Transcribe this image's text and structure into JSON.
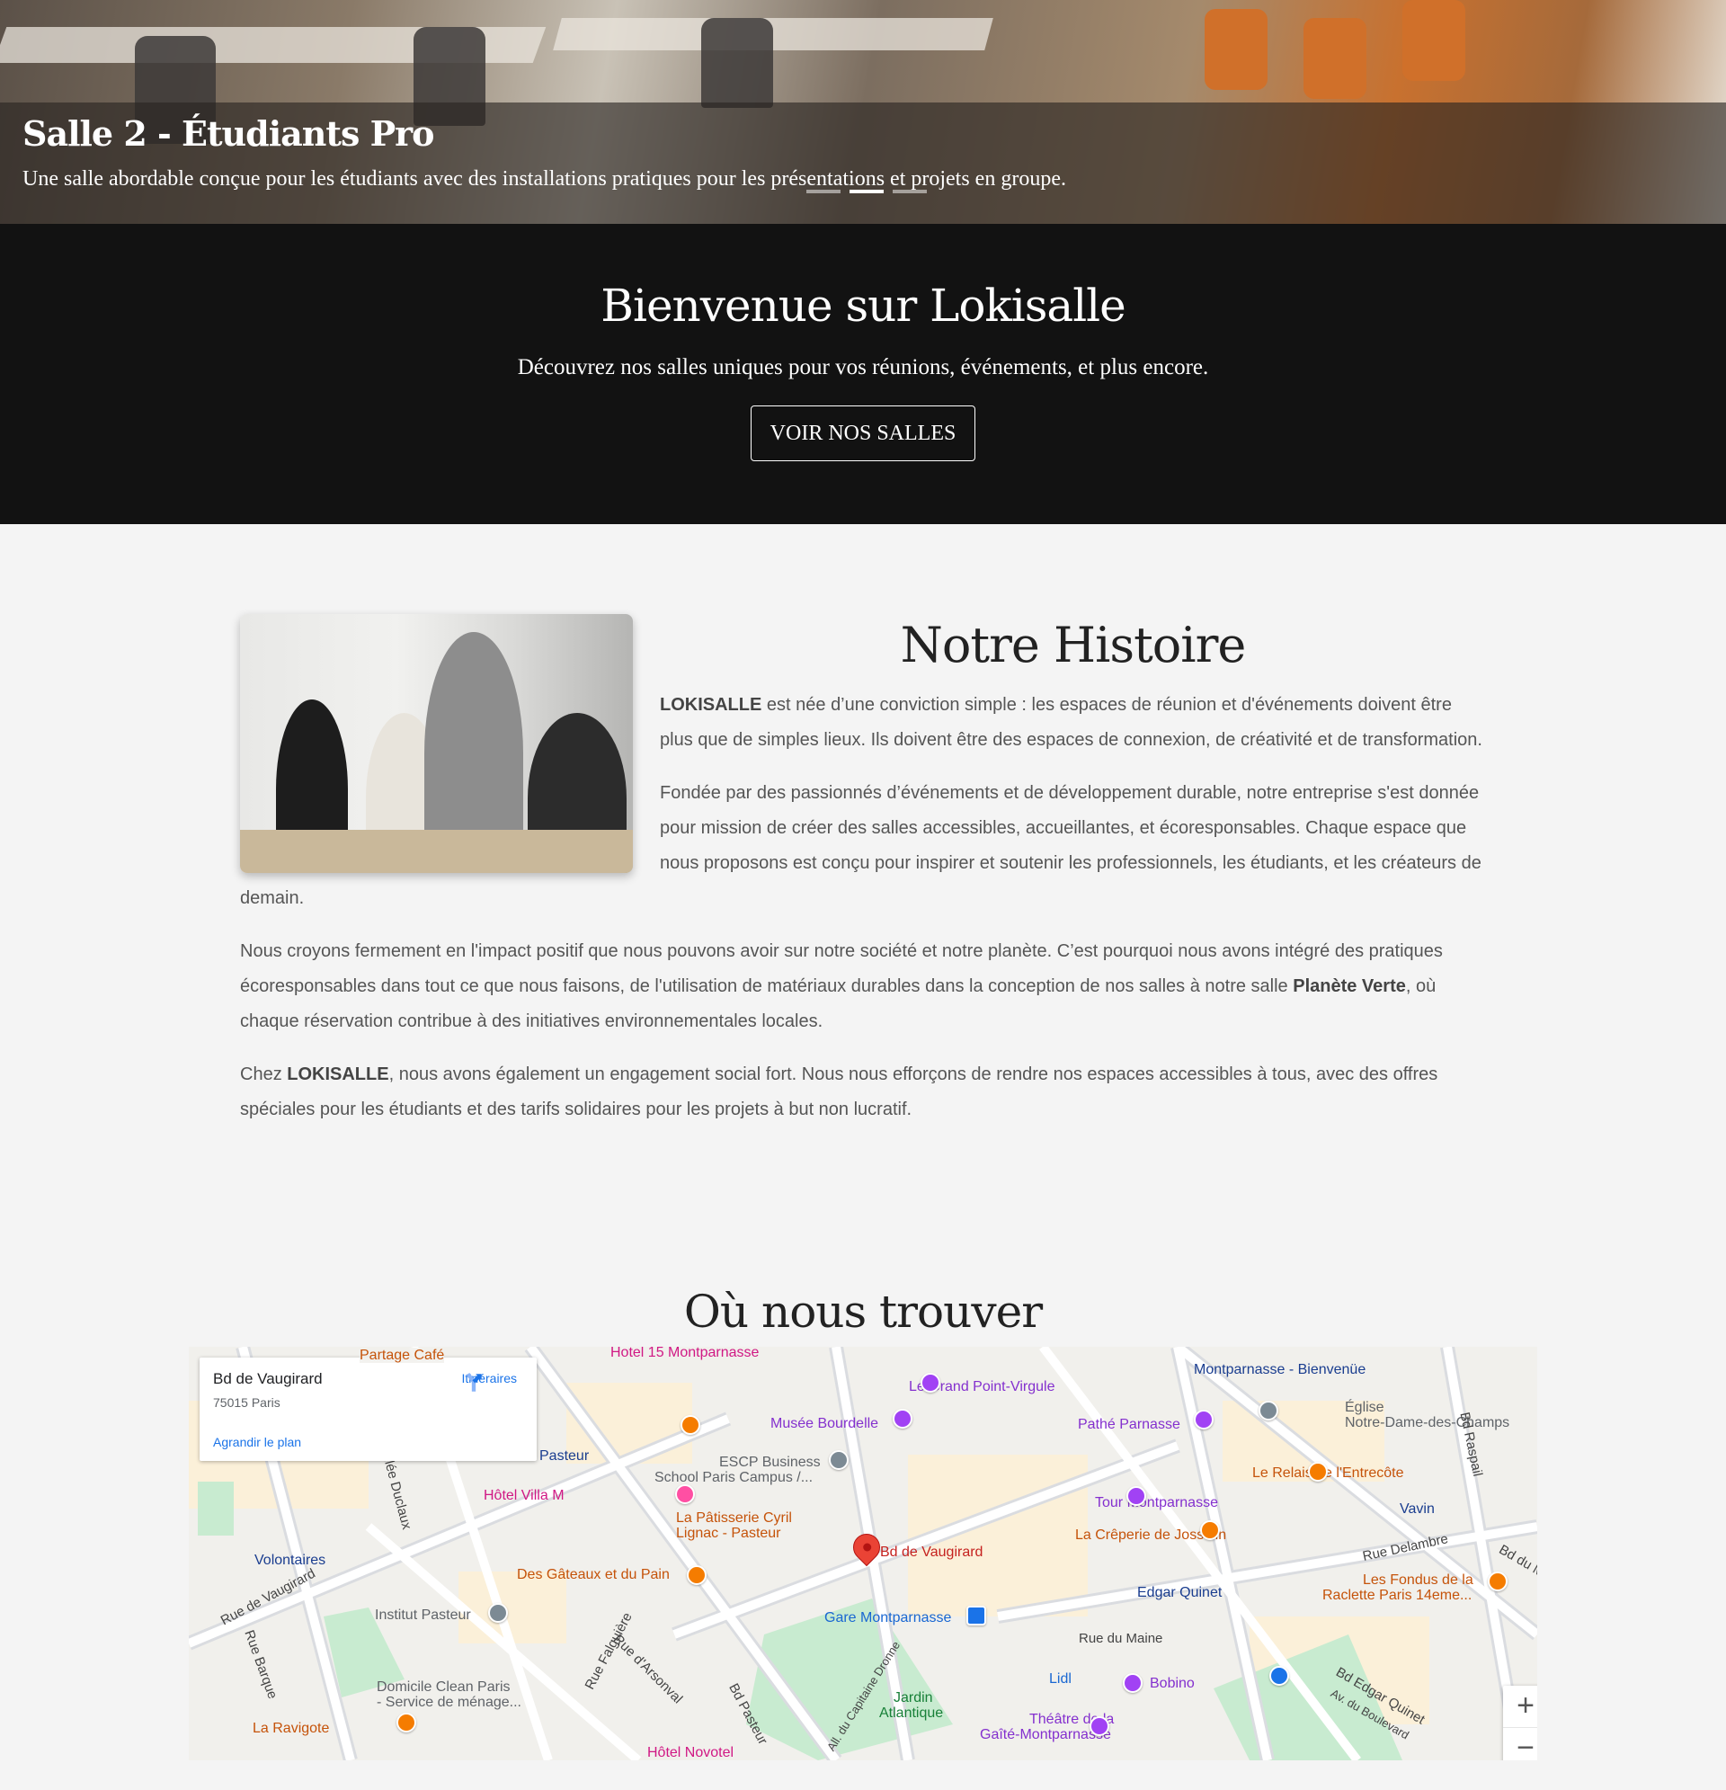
{
  "hero": {
    "title": "Salle 2 - Étudiants Pro",
    "subtitle": "Une salle abordable conçue pour les étudiants avec des installations pratiques pour les présentations et projets en groupe.",
    "slide_count": 3,
    "active_slide": 2
  },
  "welcome": {
    "title": "Bienvenue sur Lokisalle",
    "subtitle": "Découvrez nos salles uniques pour vos réunions, événements, et plus encore.",
    "button": "VOIR NOS SALLES"
  },
  "history": {
    "title": "Notre Histoire",
    "p1_bold": "LOKISALLE",
    "p1": " est née d’une conviction simple : les espaces de réunion et d'événements doivent être plus que de simples lieux. Ils doivent être des espaces de connexion, de créativité et de transformation.",
    "p2": "Fondée par des passionnés d’événements et de développement durable, notre entreprise s'est donnée pour mission de créer des salles accessibles, accueillantes, et écoresponsables. Chaque espace que nous proposons est conçu pour inspirer et soutenir les professionnels, les étudiants, et les créateurs de demain.",
    "p3a": "Nous croyons fermement en l'impact positif que nous pouvons avoir sur notre société et notre planète. C’est pourquoi nous avons intégré des pratiques écoresponsables dans tout ce que nous faisons, de l'utilisation de matériaux durables dans la conception de nos salles à notre salle ",
    "p3_bold": "Planète Verte",
    "p3b": ", où chaque réservation contribue à des initiatives environnementales locales.",
    "p4a": "Chez ",
    "p4_bold": "LOKISALLE",
    "p4b": ", nous avons également un engagement social fort. Nous nous efforçons de rendre nos espaces accessibles à tous, avec des offres spéciales pour les étudiants et des tarifs solidaires pour les projets à but non lucratif."
  },
  "location": {
    "title": "Où nous trouver",
    "card": {
      "place": "Bd de Vaugirard",
      "address": "75015 Paris",
      "enlarge": "Agrandir le plan",
      "directions": "Itinéraires"
    },
    "marker_label": "Bd de Vaugirard",
    "labels": [
      "Hotel 15 Montparnasse",
      "Partage Café",
      "Le Grand Point-Virgule",
      "Montparnasse - Bienvenüe",
      "Musée Bourdelle",
      "Pathé Parnasse",
      "Église",
      "Notre-Dame-des-Champs",
      "ESCP Business",
      "School Paris Campus /...",
      "Le Relais de l'Entrecôte",
      "Hôtel Villa M",
      "Tour Montparnasse",
      "Vavin",
      "La Pâtisserie Cyril",
      "Lignac - Pasteur",
      "La Crêperie de Josselin",
      "Volontaires",
      "Rue Delambre",
      "Des Gâteaux et du Pain",
      "Les Fondus de la",
      "Raclette Paris 14eme...",
      "Edgar Quinet",
      "Institut Pasteur",
      "Gare Montparnasse",
      "Rue du Maine",
      "Lidl",
      "Bobino",
      "Domicile Clean Paris",
      "- Service de ménage...",
      "Jardin",
      "Atlantique",
      "Théâtre de la",
      "Gaîté-Montparnasse",
      "La Ravigote",
      "Hôtel Novotel",
      "Pasteur",
      "Rue de Vaugirard",
      "Rue Falguière",
      "Rue d'Arsonval",
      "Bd Pasteur",
      "Bd Raspail",
      "Bd Edgar Quinet",
      "Av. du Boulevard",
      "Rue Barque",
      "Allée Duclaux",
      "All. du Capitaine Dronne",
      "Bd du M"
    ],
    "zoom_in": "+",
    "zoom_out": "−"
  }
}
